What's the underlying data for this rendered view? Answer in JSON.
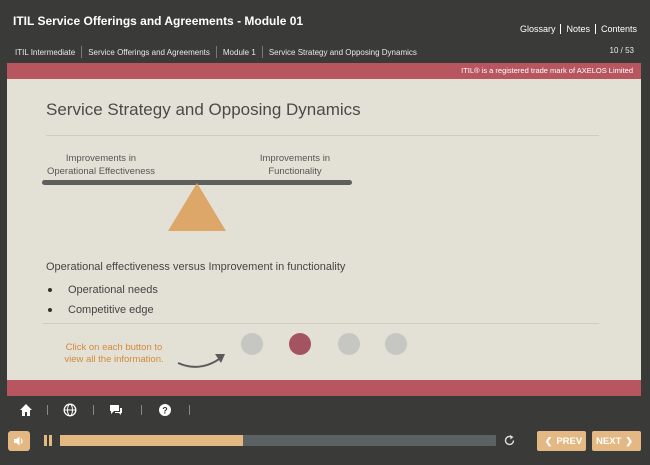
{
  "header": {
    "course_title": "ITIL Service Offerings and Agreements - Module 01",
    "links": [
      "Glossary",
      "Notes",
      "Contents"
    ],
    "breadcrumbs": [
      "ITIL Intermediate",
      "Service Offerings and Agreements",
      "Module 1",
      "Service Strategy and Opposing Dynamics"
    ],
    "page_count": "10 / 53"
  },
  "trademark": "ITIL® is a registered trade mark of AXELOS Limited",
  "slide": {
    "title": "Service Strategy and Opposing Dynamics",
    "balance": {
      "left_label": [
        "Improvements in",
        "Operational Effectiveness"
      ],
      "right_label": [
        "Improvements in",
        "Functionality"
      ]
    },
    "intro": "Operational effectiveness versus Improvement in functionality",
    "bullets": [
      "Operational needs",
      "Competitive edge"
    ],
    "hint": [
      "Click on each button to",
      "view all the information."
    ],
    "steps": {
      "count": 4,
      "active_index": 1
    }
  },
  "toolbar": {
    "icons": [
      "home-icon",
      "globe-icon",
      "chat-icon",
      "help-icon"
    ]
  },
  "player": {
    "progress": 0.42,
    "prev_label": "PREV",
    "next_label": "NEXT",
    "colors": {
      "accent": "#e3b883",
      "brand": "#b85660",
      "active_step": "#a45360"
    }
  }
}
